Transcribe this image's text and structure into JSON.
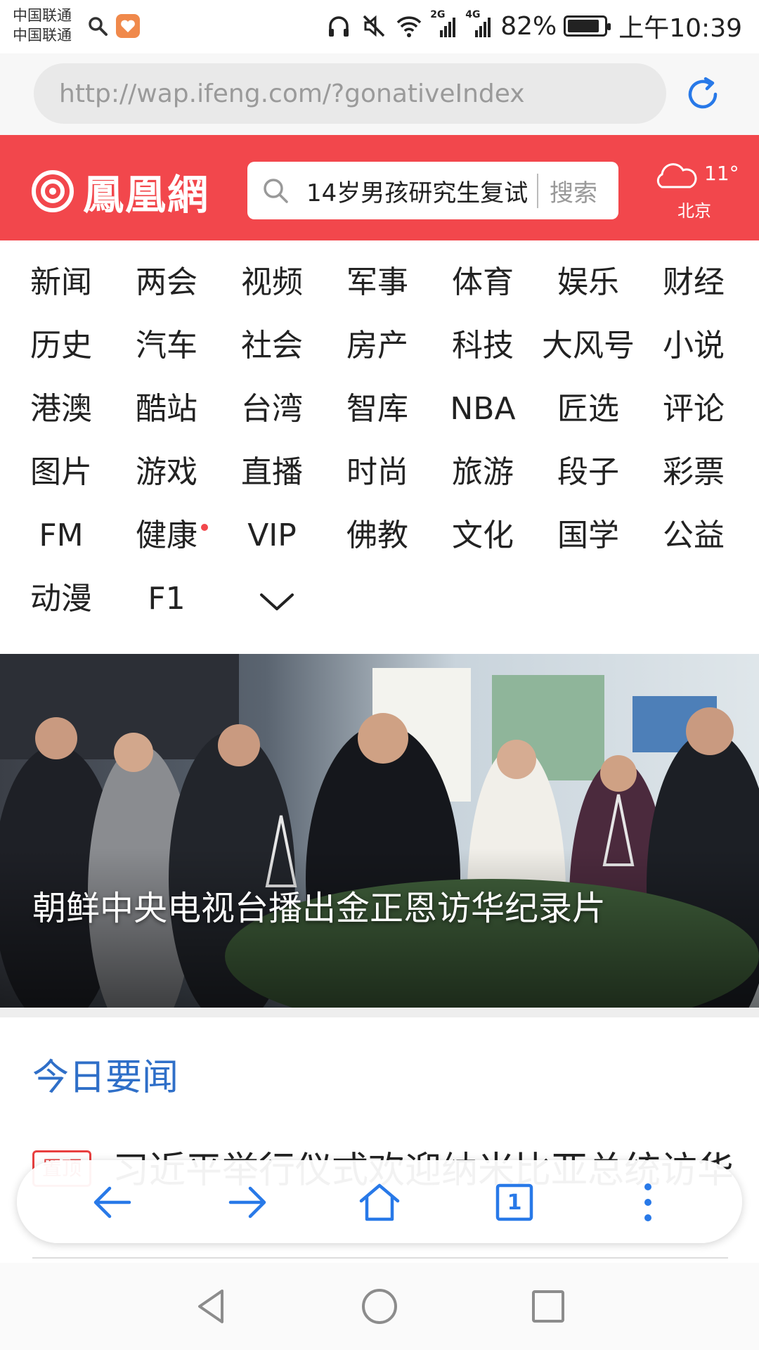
{
  "status_bar": {
    "carrier_1": "中国联通",
    "carrier_2": "中国联通",
    "net_2g": "2G",
    "net_4g": "4G",
    "battery": "82%",
    "time": "上午10:39"
  },
  "browser": {
    "url": "http://wap.ifeng.com/?gonativeIndex",
    "tab_count": "1",
    "accent_color": "#2879e8"
  },
  "header": {
    "logo_text": "鳳凰網",
    "search_text": "14岁男孩研究生复试",
    "search_button": "搜索",
    "weather_temp": "11°",
    "weather_city": "北京",
    "brand_color": "#f2474c"
  },
  "channels": {
    "rows": [
      [
        "新闻",
        "两会",
        "视频",
        "军事",
        "体育",
        "娱乐",
        "财经"
      ],
      [
        "历史",
        "汽车",
        "社会",
        "房产",
        "科技",
        "大风号",
        "小说"
      ],
      [
        "港澳",
        "酷站",
        "台湾",
        "智库",
        "NBA",
        "匠选",
        "评论"
      ],
      [
        "图片",
        "游戏",
        "直播",
        "时尚",
        "旅游",
        "段子",
        "彩票"
      ],
      [
        "FM",
        "健康",
        "VIP",
        "佛教",
        "文化",
        "国学",
        "公益"
      ],
      [
        "动漫",
        "F1"
      ]
    ],
    "more_icon": "chevron-down-icon"
  },
  "hero": {
    "caption": "朝鲜中央电视台播出金正恩访华纪录片"
  },
  "news": {
    "section_title": "今日要闻",
    "items": [
      {
        "tag": "置顶",
        "title": "习近平举行仪式欢迎纳米比亚总统访华"
      }
    ]
  }
}
